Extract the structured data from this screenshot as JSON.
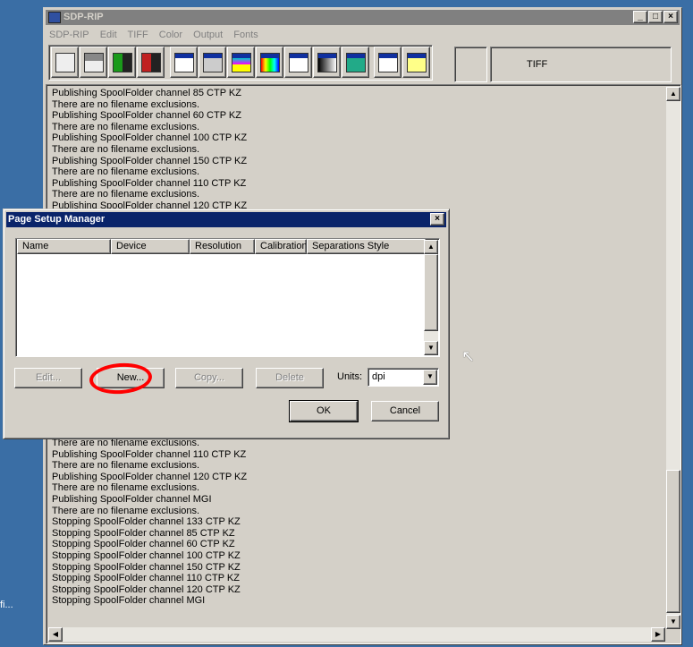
{
  "desktop": {
    "icon_label": "fi..."
  },
  "window": {
    "title": "SDP-RIP",
    "menu": [
      "SDP-RIP",
      "Edit",
      "TIFF",
      "Color",
      "Output",
      "Fonts"
    ],
    "toolbar": [
      "open-print-icon",
      "print-setup-icon",
      "start-traffic-light-icon",
      "stop-traffic-light-icon",
      "page-setup-icon",
      "device-icon",
      "separations-icon",
      "color-bar-icon",
      "calibration-icon",
      "screening-icon",
      "layers-icon",
      "output-arrow-icon",
      "fonts-icon"
    ],
    "status_panes": [
      "",
      "TIFF"
    ],
    "log_top": [
      "Publishing SpoolFolder channel 85 CTP KZ",
      "There are no filename exclusions.",
      "Publishing SpoolFolder channel 60 CTP KZ",
      "There are no filename exclusions.",
      "Publishing SpoolFolder channel 100 CTP KZ",
      "There are no filename exclusions.",
      "Publishing SpoolFolder channel 150 CTP KZ",
      "There are no filename exclusions.",
      "Publishing SpoolFolder channel 110 CTP KZ",
      "There are no filename exclusions.",
      "Publishing SpoolFolder channel 120 CTP KZ"
    ],
    "log_bottom": [
      "There are no filename exclusions.",
      "Publishing SpoolFolder channel 110 CTP KZ",
      "There are no filename exclusions.",
      "Publishing SpoolFolder channel 120 CTP KZ",
      "There are no filename exclusions.",
      "Publishing SpoolFolder channel MGI",
      "There are no filename exclusions.",
      "Stopping SpoolFolder channel 133 CTP KZ",
      "Stopping SpoolFolder channel 85 CTP KZ",
      "Stopping SpoolFolder channel 60 CTP KZ",
      "Stopping SpoolFolder channel 100 CTP KZ",
      "Stopping SpoolFolder channel 150 CTP KZ",
      "Stopping SpoolFolder channel 110 CTP KZ",
      "Stopping SpoolFolder channel 120 CTP KZ",
      "Stopping SpoolFolder channel MGI"
    ]
  },
  "dialog": {
    "title": "Page Setup Manager",
    "columns": [
      "Name",
      "Device",
      "Resolution",
      "Calibration",
      "Separations Style"
    ],
    "buttons": {
      "edit": "Edit...",
      "new": "New...",
      "copy": "Copy...",
      "delete": "Delete",
      "ok": "OK",
      "cancel": "Cancel"
    },
    "units_label": "Units:",
    "units_value": "dpi"
  },
  "colors": {
    "desktop": "#3a6ea5",
    "active_title": "#0a246a",
    "annotation": "#ff0000"
  }
}
